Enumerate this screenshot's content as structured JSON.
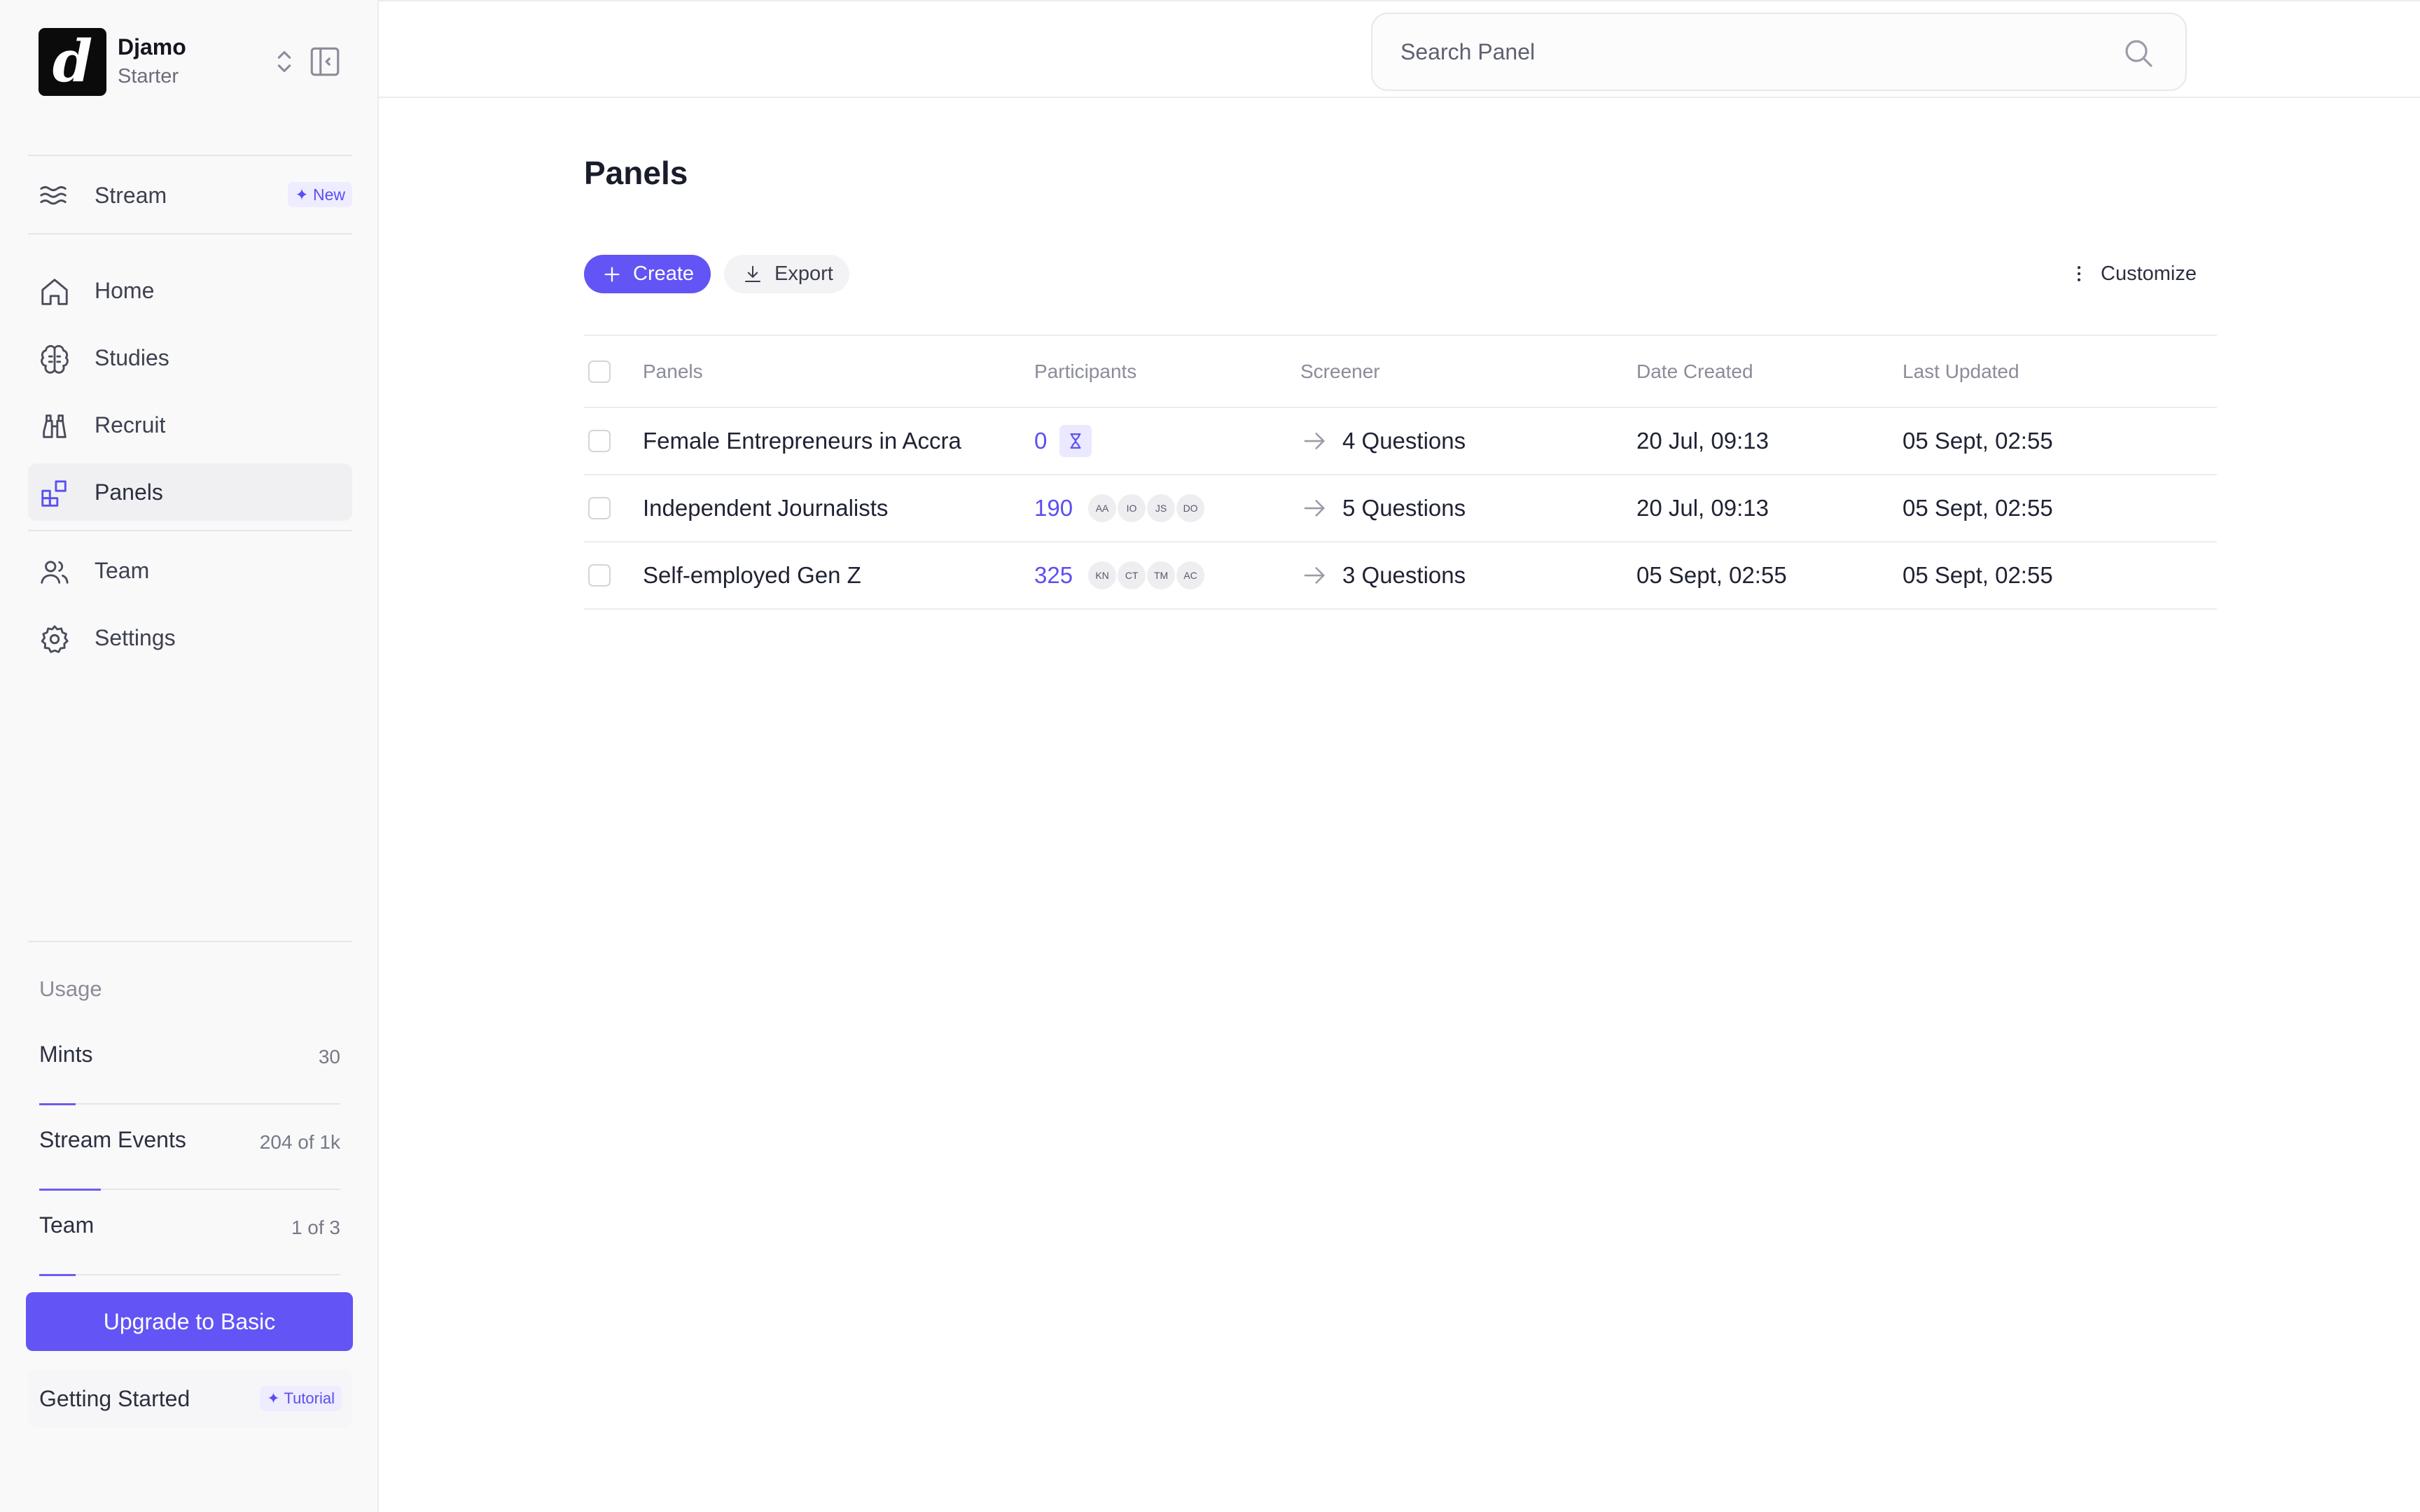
{
  "workspace": {
    "name": "Djamo",
    "plan": "Starter",
    "logo_letter": "d"
  },
  "nav": {
    "stream": {
      "label": "Stream",
      "badge": "✦ New"
    },
    "items": [
      {
        "label": "Home",
        "icon": "home-icon"
      },
      {
        "label": "Studies",
        "icon": "brain-icon"
      },
      {
        "label": "Recruit",
        "icon": "binoculars-icon"
      },
      {
        "label": "Panels",
        "icon": "panels-icon",
        "active": true
      },
      {
        "label": "Team",
        "icon": "users-icon"
      },
      {
        "label": "Settings",
        "icon": "gear-icon"
      }
    ]
  },
  "usage": {
    "title": "Usage",
    "rows": [
      {
        "label": "Mints",
        "value": "30",
        "progress": 0.12
      },
      {
        "label": "Stream Events",
        "value": "204 of 1k",
        "progress": 0.204
      },
      {
        "label": "Team",
        "value": "1 of 3",
        "progress": 0.12
      }
    ]
  },
  "upgrade_label": "Upgrade to Basic",
  "getting_started": {
    "label": "Getting Started",
    "badge": "✦ Tutorial"
  },
  "search": {
    "placeholder": "Search Panel",
    "value": ""
  },
  "page": {
    "title": "Panels"
  },
  "toolbar": {
    "create_label": "Create",
    "export_label": "Export",
    "customize_label": "Customize"
  },
  "table": {
    "columns": [
      "Panels",
      "Participants",
      "Screener",
      "Date Created",
      "Last Updated"
    ],
    "rows": [
      {
        "name": "Female Entrepreneurs in Accra",
        "participants": "0",
        "status": "pending",
        "avatars": [],
        "screener": "4 Questions",
        "created": "20 Jul, 09:13",
        "updated": "05 Sept, 02:55"
      },
      {
        "name": "Independent Journalists",
        "participants": "190",
        "status": "ready",
        "avatars": [
          "AA",
          "IO",
          "JS",
          "DO"
        ],
        "screener": "5 Questions",
        "created": "20 Jul, 09:13",
        "updated": "05 Sept, 02:55"
      },
      {
        "name": "Self-employed Gen Z",
        "participants": "325",
        "status": "ready",
        "avatars": [
          "KN",
          "CT",
          "TM",
          "AC"
        ],
        "screener": "3 Questions",
        "created": "05 Sept, 02:55",
        "updated": "05 Sept, 02:55"
      }
    ]
  },
  "colors": {
    "accent": "#6354f5",
    "accent_text": "#5b4ff0",
    "badge_bg": "#eeecff"
  }
}
